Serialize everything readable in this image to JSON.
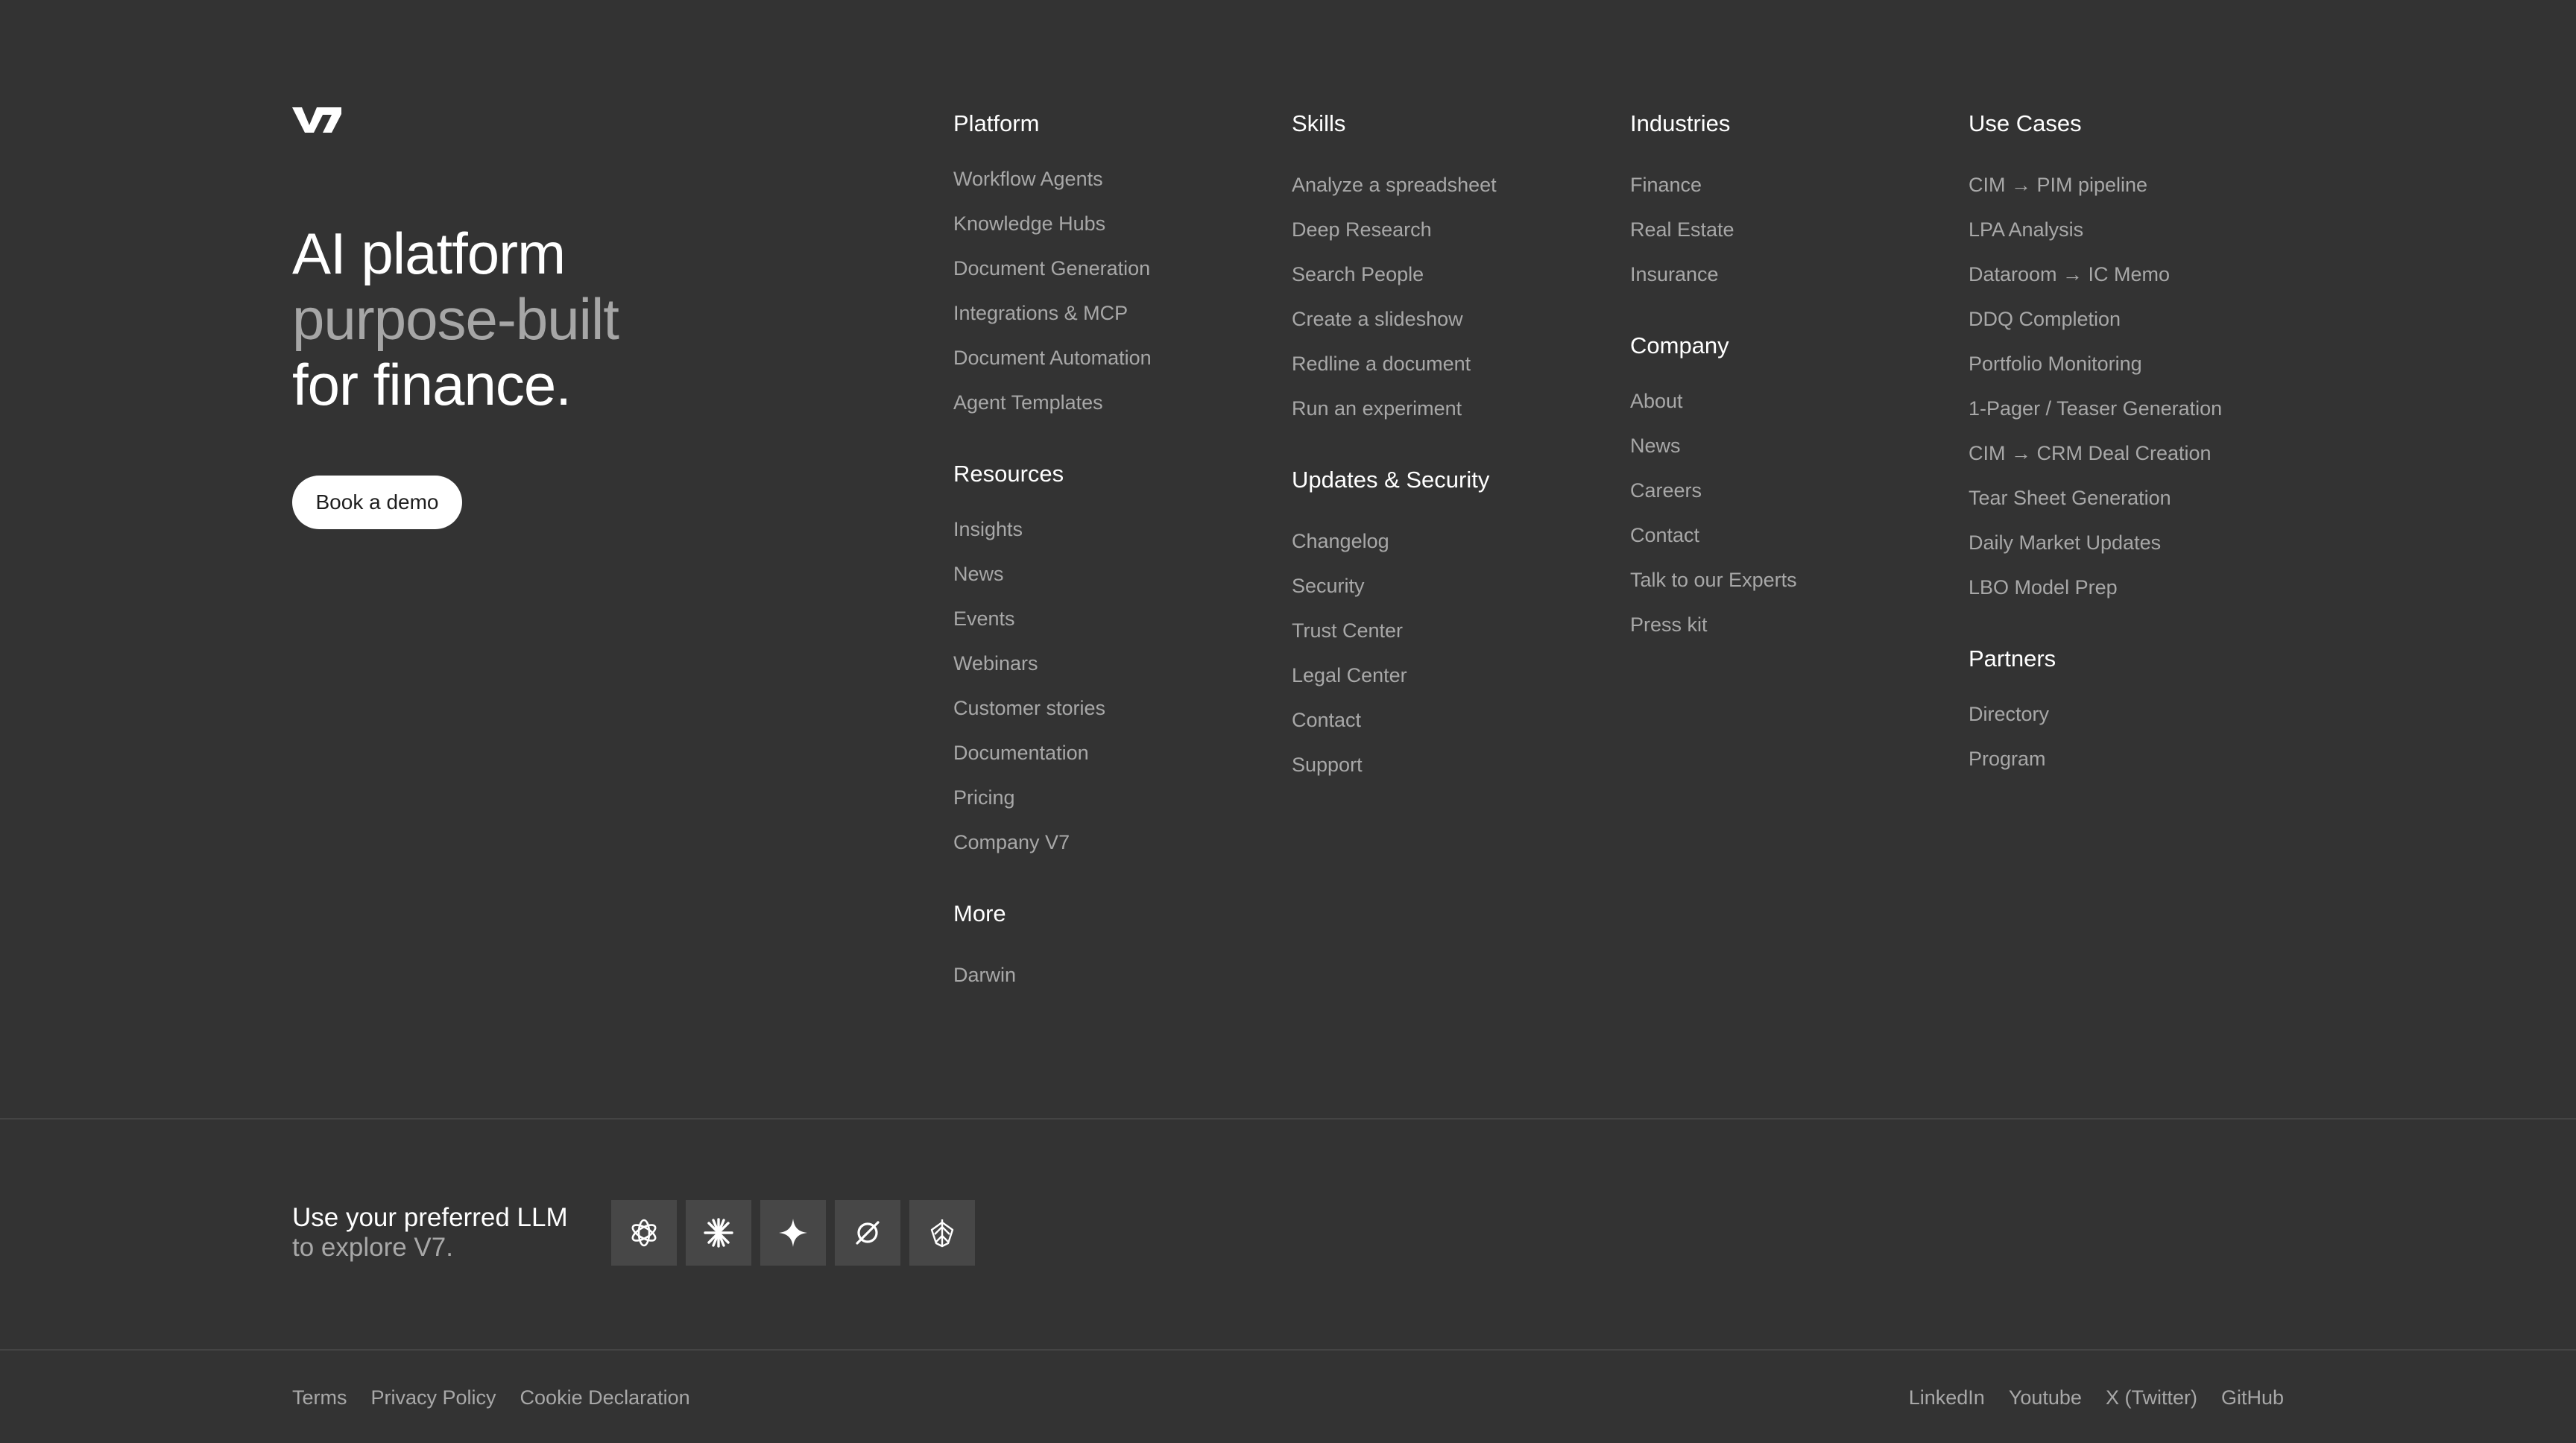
{
  "brand": {
    "logo_text": "V7"
  },
  "hero": {
    "line1": "AI platform",
    "line2": "purpose-built",
    "line3": "for finance.",
    "cta_label": "Book a demo"
  },
  "columns": {
    "platform": {
      "heading": "Platform",
      "items": [
        "Workflow Agents",
        "Knowledge Hubs",
        "Document Generation",
        "Integrations & MCP",
        "Document Automation",
        "Agent Templates"
      ]
    },
    "resources": {
      "heading": "Resources",
      "items": [
        "Insights",
        "News",
        "Events",
        "Webinars",
        "Customer stories",
        "Documentation",
        "Pricing",
        "Company V7"
      ]
    },
    "more": {
      "heading": "More",
      "items": [
        "Darwin"
      ]
    },
    "skills": {
      "heading": "Skills",
      "items": [
        "Analyze a spreadsheet",
        "Deep Research",
        "Search People",
        "Create a slideshow",
        "Redline a document",
        "Run an experiment"
      ]
    },
    "updates": {
      "heading": "Updates & Security",
      "items": [
        "Changelog",
        "Security",
        "Trust Center",
        "Legal Center",
        "Contact",
        "Support"
      ]
    },
    "industries": {
      "heading": "Industries",
      "items": [
        "Finance",
        "Real Estate",
        "Insurance"
      ]
    },
    "company": {
      "heading": "Company",
      "items": [
        "About",
        "News",
        "Careers",
        "Contact",
        "Talk to our Experts",
        "Press kit"
      ]
    },
    "usecases": {
      "heading": "Use Cases",
      "items": [
        "CIM → PIM pipeline",
        "LPA Analysis",
        "Dataroom → IC Memo",
        "DDQ Completion",
        "Portfolio Monitoring",
        "1-Pager / Teaser Generation",
        "CIM → CRM Deal Creation",
        "Tear Sheet Generation",
        "Daily Market Updates",
        "LBO Model Prep"
      ]
    },
    "partners": {
      "heading": "Partners",
      "items": [
        "Directory",
        "Program"
      ]
    }
  },
  "llm": {
    "line1": "Use your preferred LLM",
    "line2": "to explore V7.",
    "icons": [
      "openai-icon",
      "claude-icon",
      "gemini-icon",
      "perplexity-icon",
      "grok-icon"
    ]
  },
  "footer": {
    "legal": [
      "Terms",
      "Privacy Policy",
      "Cookie Declaration"
    ],
    "social": [
      "LinkedIn",
      "Youtube",
      "X (Twitter)",
      "GitHub"
    ]
  },
  "colors": {
    "background": "#333333",
    "text_primary": "#ffffff",
    "text_muted": "#a8a8a8",
    "icon_tile": "#474747"
  }
}
